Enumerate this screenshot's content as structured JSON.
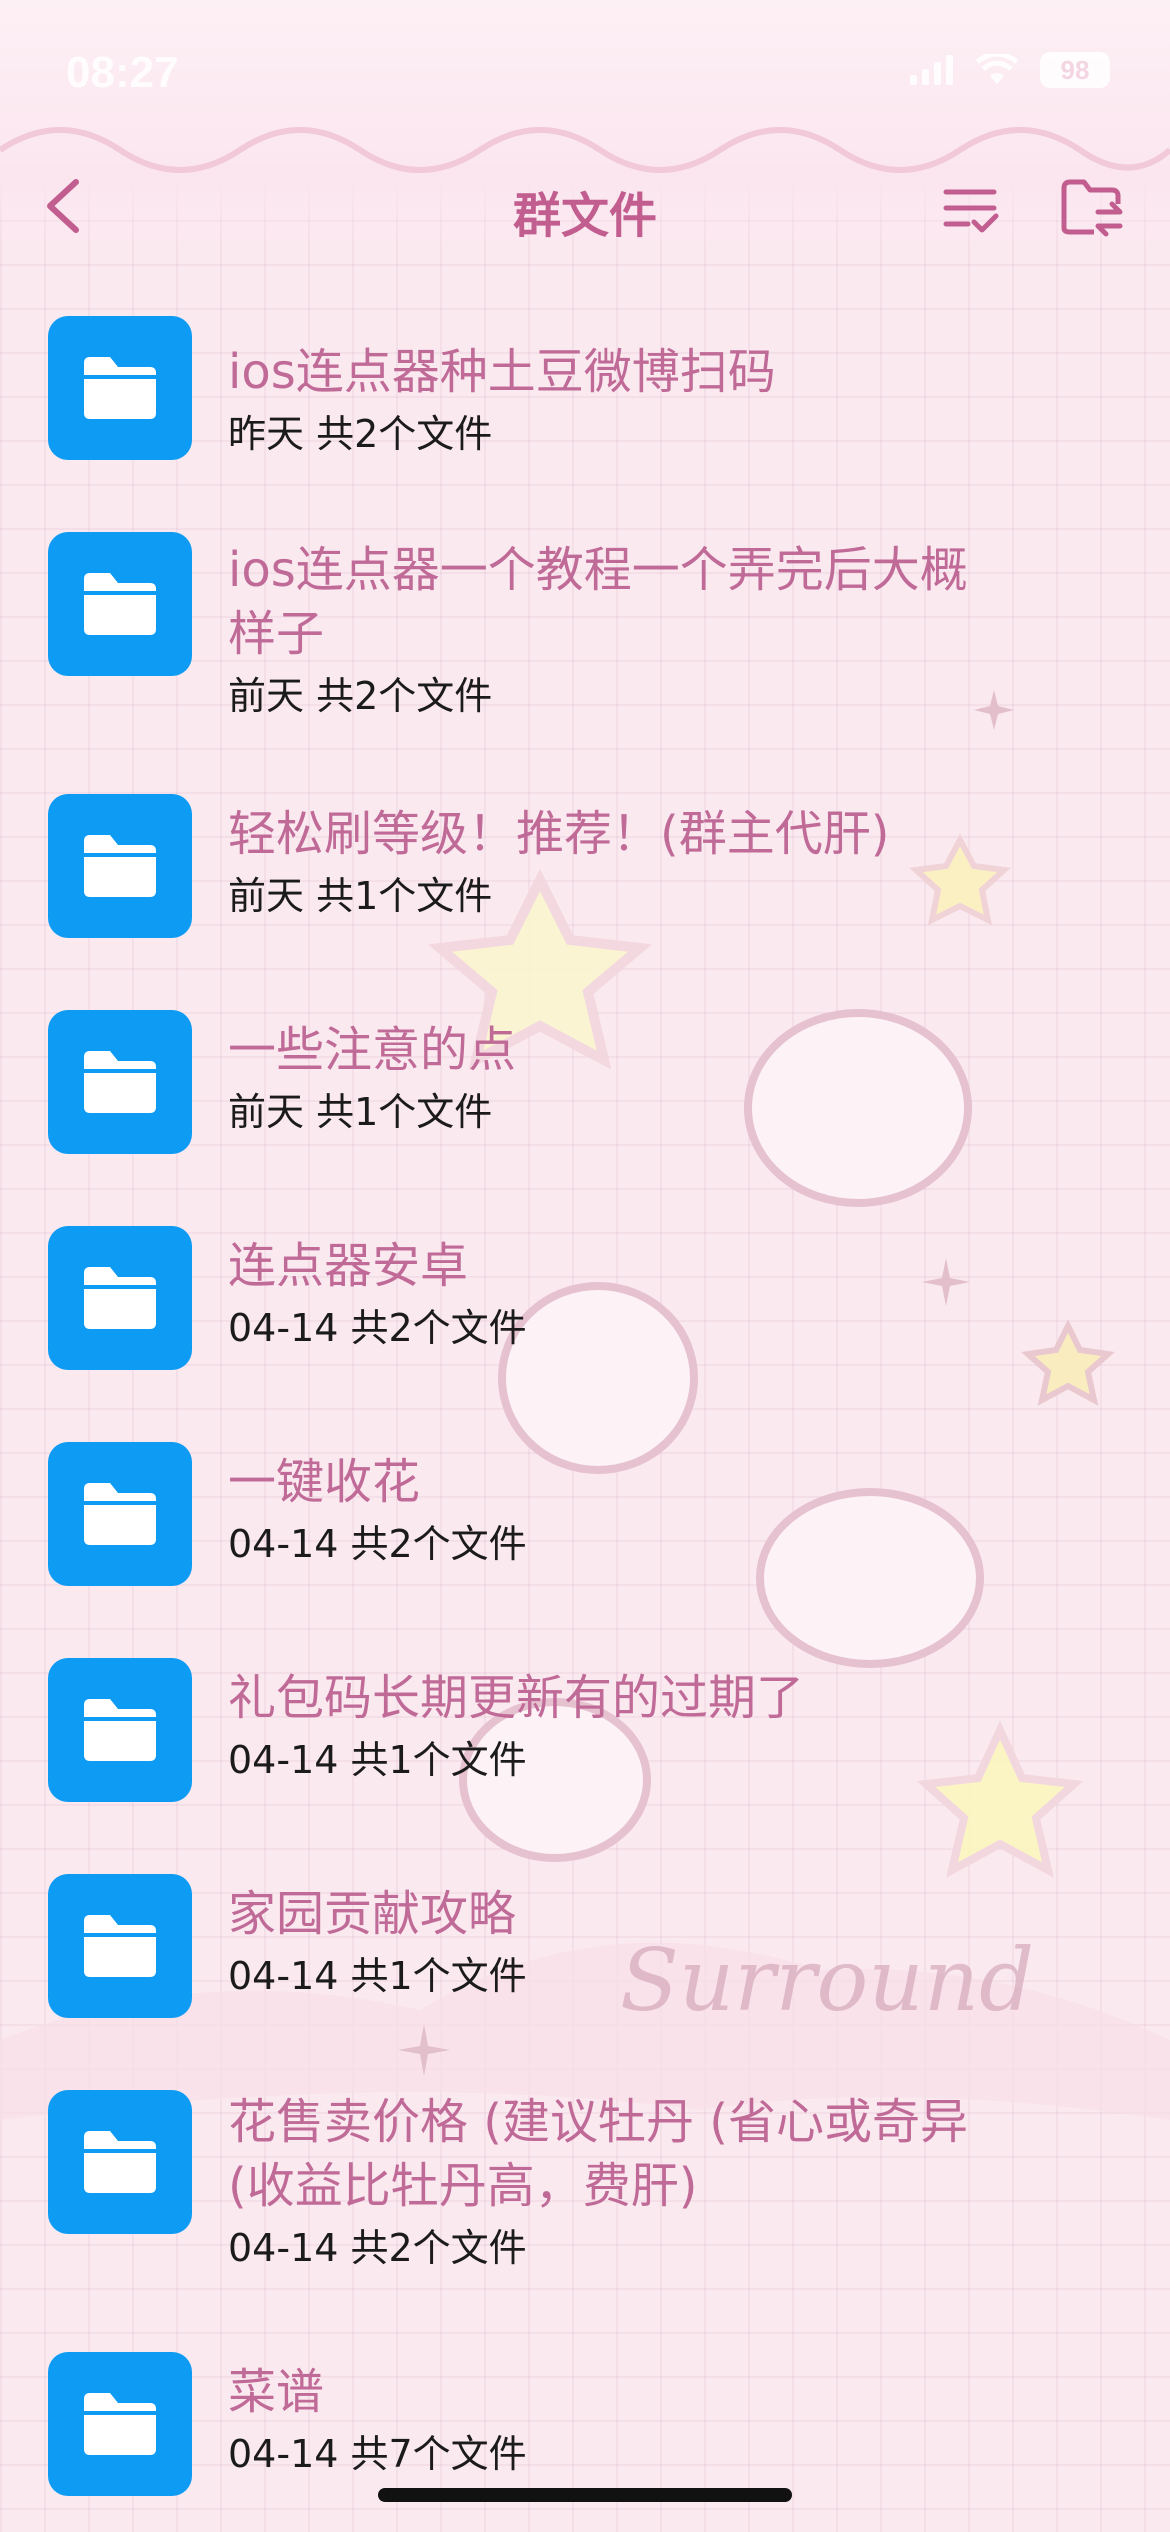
{
  "status_bar": {
    "time": "08:27",
    "battery": "98"
  },
  "nav": {
    "title": "群文件",
    "back_icon": "chevron-left-icon",
    "sort_icon": "sort-check-icon",
    "folder_icon": "folder-transfer-icon"
  },
  "colors": {
    "accent": "#c25e8f",
    "folder_blue": "#0e9bf3",
    "title_pink": "#c06a97"
  },
  "files": [
    {
      "title": "ios连点器种土豆微博扫码",
      "meta": "昨天 共2个文件"
    },
    {
      "title": "ios连点器一个教程一个弄完后大概样子",
      "meta": "前天 共2个文件"
    },
    {
      "title": "轻松刷等级！推荐！(群主代肝)",
      "meta": "前天 共1个文件"
    },
    {
      "title": "一些注意的点",
      "meta": "前天 共1个文件"
    },
    {
      "title": "连点器安卓",
      "meta": "04-14 共2个文件"
    },
    {
      "title": "一键收花",
      "meta": "04-14 共2个文件"
    },
    {
      "title": "礼包码长期更新有的过期了",
      "meta": "04-14 共1个文件"
    },
    {
      "title": "家园贡献攻略",
      "meta": "04-14 共1个文件"
    },
    {
      "title": "花售卖价格 (建议牡丹 (省心或奇异 (收益比牡丹高，费肝)",
      "meta": "04-14 共2个文件"
    },
    {
      "title": "菜谱",
      "meta": "04-14 共7个文件"
    }
  ],
  "decor": {
    "watermark": "Surround"
  }
}
